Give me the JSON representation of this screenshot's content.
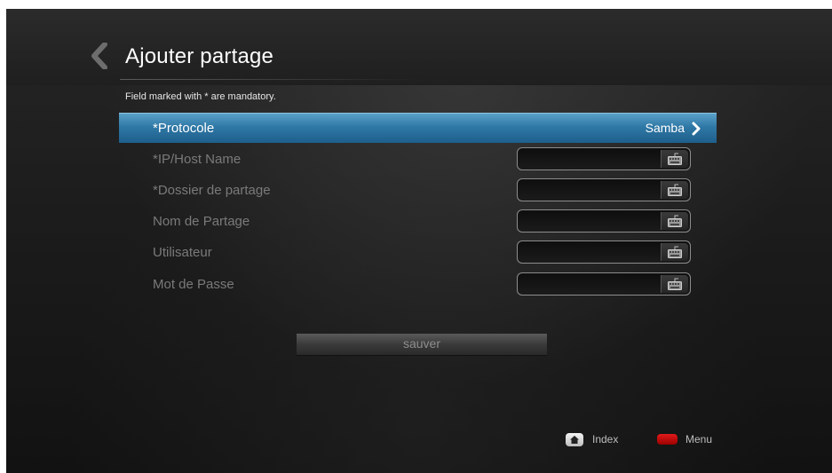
{
  "header": {
    "title": "Ajouter partage"
  },
  "form": {
    "mandatory_note": "Field marked with * are mandatory.",
    "rows": [
      {
        "label": "*Protocole",
        "value": "Samba",
        "selected": true,
        "type": "selector"
      },
      {
        "label": "*IP/Host Name",
        "value": "",
        "type": "text"
      },
      {
        "label": "*Dossier de partage",
        "value": "",
        "type": "text"
      },
      {
        "label": "Nom de Partage",
        "value": "",
        "type": "text"
      },
      {
        "label": "Utilisateur",
        "value": "",
        "type": "text"
      },
      {
        "label": "Mot de Passe",
        "value": "",
        "type": "text"
      }
    ],
    "save_label": "sauver"
  },
  "footer": {
    "index_label": "Index",
    "menu_label": "Menu"
  },
  "colors": {
    "selection_blue": "#2f78a6",
    "menu_key_red": "#e11a1a"
  },
  "icons": [
    "back-arrow-icon",
    "chevron-right-icon",
    "keyboard-icon",
    "home-icon",
    "red-key-icon"
  ]
}
